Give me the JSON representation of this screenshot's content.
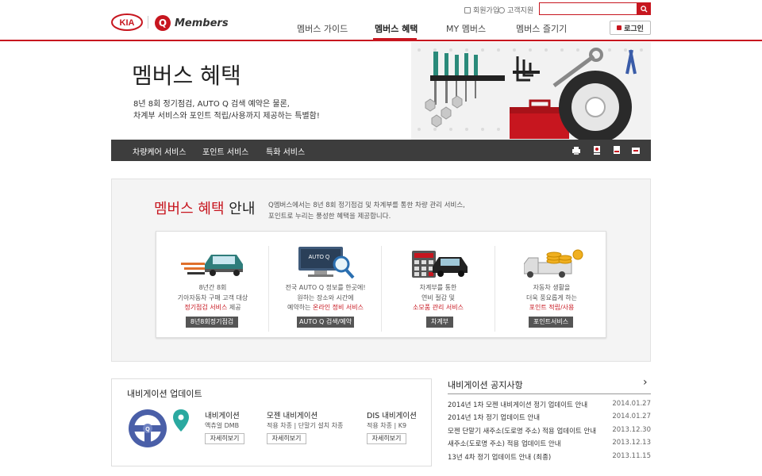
{
  "header": {
    "logo_brand": "KIA",
    "logo_q": "Q",
    "logo_members": "Members",
    "util_signup": "회원가입",
    "util_support": "고객지원",
    "search_placeholder": "",
    "nav": [
      "멤버스 가이드",
      "멤버스 혜택",
      "MY 멤버스",
      "멤버스 즐기기"
    ],
    "nav_active_index": 1,
    "login": "로그인"
  },
  "hero": {
    "title": "멤버스 혜택",
    "desc1": "8년 8회 정기점검, AUTO Q 검색 예약은 물론,",
    "desc2": "차계부 서비스와 포인트 적립/사용까지 제공하는 특별함!"
  },
  "subnav": {
    "items": [
      "차량케어 서비스",
      "포인트 서비스",
      "특화 서비스"
    ],
    "icons": [
      "print-icon",
      "mail-icon",
      "bookmark-icon",
      "share-icon"
    ]
  },
  "benefit": {
    "title_red": "멤버스 혜택",
    "title_rest": "안내",
    "desc1": "Q멤버스에서는 8년 8회 정기점검 및 차계부를 통한 차량 관리 서비스,",
    "desc2": "포인트로 누리는 풍성한 혜택을 제공합니다.",
    "cards": [
      {
        "l1": "8년간 8회",
        "l2": "기아자동차 구매 고객 대상",
        "l3_hl": "정기점검 서비스",
        "l3_rest": " 제공",
        "btn": "8년8회정기점검",
        "icon": "car-check-icon"
      },
      {
        "l1": "전국 AUTO Q 정보를 한곳에!",
        "l2": "원하는 장소와 시간에",
        "l3_pre": "예약하는 ",
        "l3_hl": "온라인 정비 서비스",
        "btn": "AUTO Q 검색/예약",
        "icon": "monitor-search-icon",
        "screen_text": "AUTO Q"
      },
      {
        "l1": "차계부를 통한",
        "l2": "연비 절감 및",
        "l3_hl": "소모품 관리 서비스",
        "btn": "차계부",
        "icon": "calculator-car-icon"
      },
      {
        "l1": "자동차 생활을",
        "l2": "더욱 풍요롭게 하는",
        "l3_hl": "포인트 적립/사용",
        "btn": "포인트서비스",
        "icon": "truck-coins-icon"
      }
    ]
  },
  "navi": {
    "title": "내비게이션 업데이트",
    "cols": [
      {
        "title": "내비게이션",
        "sub": "액츄얼 DMB",
        "btn": "자세히보기"
      },
      {
        "title": "모젠 내비게이션",
        "sub": "적용 차종 | 단말기 설치 차종",
        "btn": "자세히보기"
      },
      {
        "title": "DIS 내비게이션",
        "sub": "적용 차종 | K9",
        "btn": "자세히보기"
      }
    ]
  },
  "notices": {
    "title": "내비게이션 공지사항",
    "items": [
      {
        "title": "2014년 1차 모젠 내비게이션 정기 업데이트 안내",
        "date": "2014.01.27"
      },
      {
        "title": "2014년 1차 정기 업데이트 안내",
        "date": "2014.01.27"
      },
      {
        "title": "모젠 단말기 새주소(도로명 주소) 적용 업데이트 안내",
        "date": "2013.12.30"
      },
      {
        "title": "새주소(도로명 주소) 적용 업데이트 안내",
        "date": "2013.12.13"
      },
      {
        "title": "13년 4차 정기 업데이트 안내 (최종)",
        "date": "2013.11.15"
      }
    ]
  }
}
